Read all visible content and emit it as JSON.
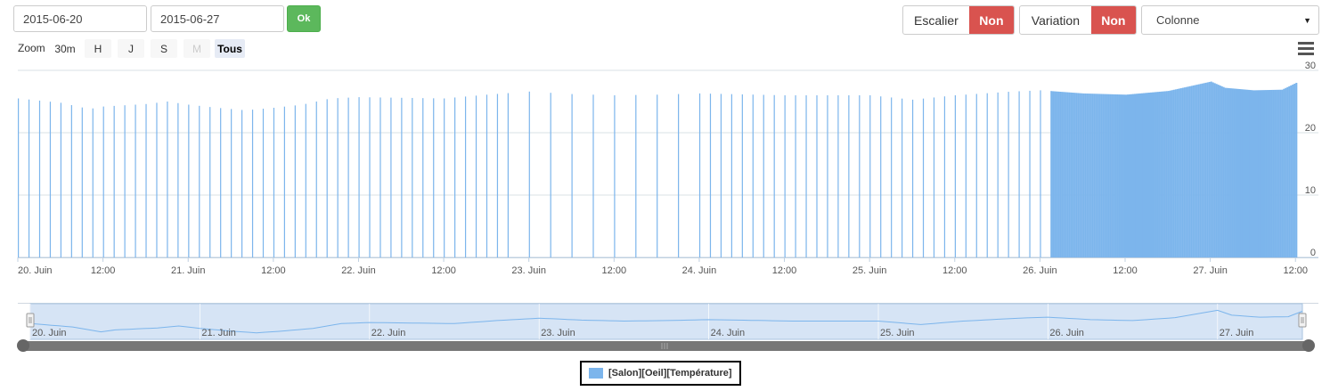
{
  "controls": {
    "start_date": "2015-06-20",
    "end_date": "2015-06-27",
    "ok_label": "Ok",
    "stair_label": "Escalier",
    "stair_value": "Non",
    "variation_label": "Variation",
    "variation_value": "Non",
    "chart_type": "Colonne",
    "zoom_label": "Zoom",
    "zoom_buttons": [
      "30m",
      "H",
      "J",
      "S",
      "M",
      "Tous"
    ],
    "zoom_active": "Tous",
    "zoom_disabled": "M"
  },
  "colors": {
    "series": "#7cb5ec",
    "navigator_fill": "#d6e4f5",
    "toggle_off": "#d9534f",
    "ok": "#5cb85c"
  },
  "chart_data": {
    "type": "bar",
    "series": [
      {
        "name": "[Salon][Oeil][Température]",
        "sparse_hours": [
          0,
          1.5,
          3,
          4.5,
          6,
          7.5,
          9,
          10.5,
          12,
          13.5,
          15,
          16.5,
          18,
          19.5,
          21,
          22.5,
          24,
          25.5,
          27,
          28.5,
          30,
          31.5,
          33,
          34.5,
          36,
          37.5,
          39,
          40.5,
          42,
          43.5,
          45,
          46.5,
          48,
          49.5,
          51,
          52.5,
          54,
          55.5,
          57,
          58.5,
          60,
          61.5,
          63,
          64.5,
          66,
          67.5,
          69,
          72,
          75,
          78,
          81,
          84,
          87,
          90,
          93,
          96,
          97.5,
          99,
          100.5,
          102,
          103.5,
          105,
          106.5,
          108,
          109.5,
          111,
          112.5,
          114,
          115.5,
          117,
          118.5,
          120,
          121.5,
          123,
          124.5,
          126,
          127.5,
          129,
          130.5,
          132,
          133.5,
          135,
          136.5,
          138,
          139.5,
          141,
          142.5,
          144,
          145.5
        ],
        "dense_from_hour": 145.5,
        "dense_to_hour": 180,
        "temperature_profile": [
          [
            0,
            25.5
          ],
          [
            6,
            24.8
          ],
          [
            10,
            23.8
          ],
          [
            12,
            24.2
          ],
          [
            18,
            24.6
          ],
          [
            21,
            25
          ],
          [
            24,
            24.5
          ],
          [
            28,
            24
          ],
          [
            32,
            23.6
          ],
          [
            36,
            24
          ],
          [
            40,
            24.5
          ],
          [
            44,
            25.5
          ],
          [
            48,
            25.7
          ],
          [
            60,
            25.5
          ],
          [
            66,
            26.1
          ],
          [
            72,
            26.6
          ],
          [
            78,
            26.2
          ],
          [
            84,
            26.0
          ],
          [
            90,
            26.1
          ],
          [
            96,
            26.3
          ],
          [
            108,
            26.0
          ],
          [
            120,
            26.0
          ],
          [
            126,
            25.3
          ],
          [
            132,
            26.0
          ],
          [
            140,
            26.6
          ],
          [
            144,
            26.8
          ],
          [
            150,
            26.3
          ],
          [
            156,
            26.1
          ],
          [
            162,
            26.7
          ],
          [
            168,
            28.2
          ],
          [
            170,
            27.2
          ],
          [
            174,
            26.8
          ],
          [
            178,
            26.9
          ],
          [
            180,
            28.0
          ]
        ]
      }
    ],
    "x_start": "2015-06-20 00:00",
    "x_end": "2015-06-27 13:00",
    "x_tick_labels": [
      "20. Juin",
      "12:00",
      "21. Juin",
      "12:00",
      "22. Juin",
      "12:00",
      "23. Juin",
      "12:00",
      "24. Juin",
      "12:00",
      "25. Juin",
      "12:00",
      "26. Juin",
      "12:00",
      "27. Juin",
      "12:00"
    ],
    "x_tick_hours": [
      0,
      12,
      24,
      36,
      48,
      60,
      72,
      84,
      96,
      108,
      120,
      132,
      144,
      156,
      168,
      180
    ],
    "y_ticks": [
      0,
      10,
      20,
      30
    ],
    "ylim": [
      0,
      30
    ],
    "navigator_labels": [
      "20. Juin",
      "21. Juin",
      "22. Juin",
      "23. Juin",
      "24. Juin",
      "25. Juin",
      "26. Juin",
      "27. Juin"
    ],
    "navigator_label_hours": [
      0,
      24,
      48,
      72,
      96,
      120,
      144,
      168
    ],
    "legend": "[Salon][Oeil][Température]",
    "legend_position": "bottom-center",
    "grid": true
  }
}
